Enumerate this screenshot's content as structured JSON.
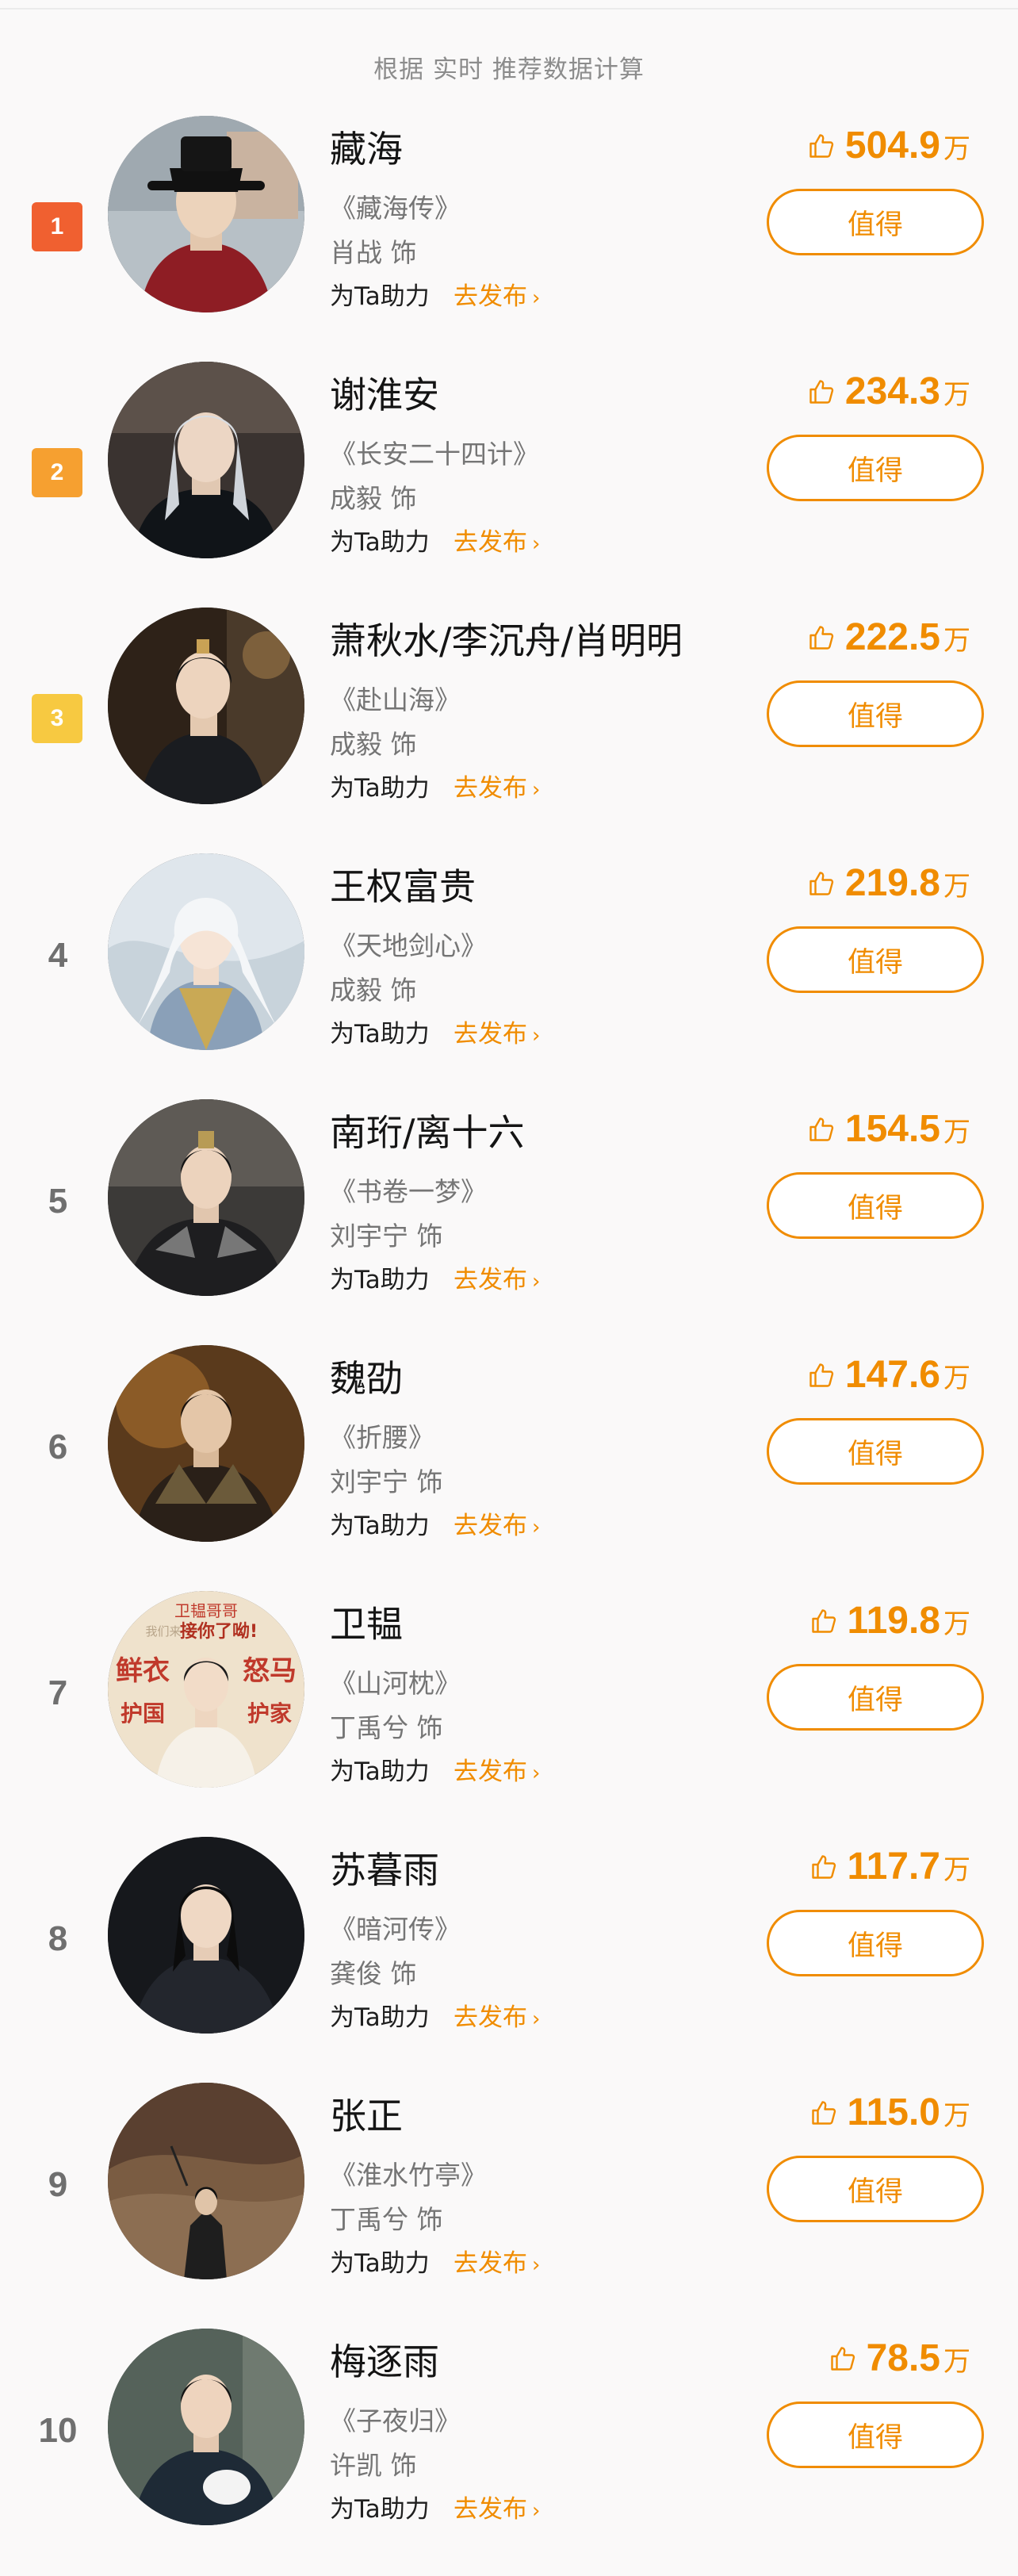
{
  "header": {
    "subtitle": "根据 实时 推荐数据计算"
  },
  "labels": {
    "help": "为Ta助力",
    "publish": "去发布",
    "worth": "值得",
    "unit": "万"
  },
  "colors": {
    "accent": "#f08c00",
    "rank1": "#f06030",
    "rank2": "#f6a030",
    "rank3": "#f7c941"
  },
  "icons": {
    "like": "thumbs-up-icon",
    "chevron": "chevron-right-icon"
  },
  "items": [
    {
      "rank": "1",
      "name": "藏海",
      "drama": "《藏海传》",
      "actor": "肖战 饰",
      "likes": "504.9"
    },
    {
      "rank": "2",
      "name": "谢淮安",
      "drama": "《长安二十四计》",
      "actor": "成毅 饰",
      "likes": "234.3"
    },
    {
      "rank": "3",
      "name": "萧秋水/李沉舟/肖明明",
      "drama": "《赴山海》",
      "actor": "成毅 饰",
      "likes": "222.5"
    },
    {
      "rank": "4",
      "name": "王权富贵",
      "drama": "《天地剑心》",
      "actor": "成毅 饰",
      "likes": "219.8"
    },
    {
      "rank": "5",
      "name": "南珩/离十六",
      "drama": "《书卷一梦》",
      "actor": "刘宇宁 饰",
      "likes": "154.5"
    },
    {
      "rank": "6",
      "name": "魏劭",
      "drama": "《折腰》",
      "actor": "刘宇宁 饰",
      "likes": "147.6"
    },
    {
      "rank": "7",
      "name": "卫韫",
      "drama": "《山河枕》",
      "actor": "丁禹兮 饰",
      "likes": "119.8",
      "avatar_text": [
        "卫韫哥哥",
        "我们来",
        "接你了呦!",
        "鲜衣",
        "怒马",
        "护国",
        "护家"
      ]
    },
    {
      "rank": "8",
      "name": "苏暮雨",
      "drama": "《暗河传》",
      "actor": "龚俊 饰",
      "likes": "117.7"
    },
    {
      "rank": "9",
      "name": "张正",
      "drama": "《淮水竹亭》",
      "actor": "丁禹兮 饰",
      "likes": "115.0"
    },
    {
      "rank": "10",
      "name": "梅逐雨",
      "drama": "《子夜归》",
      "actor": "许凯 饰",
      "likes": "78.5"
    }
  ]
}
